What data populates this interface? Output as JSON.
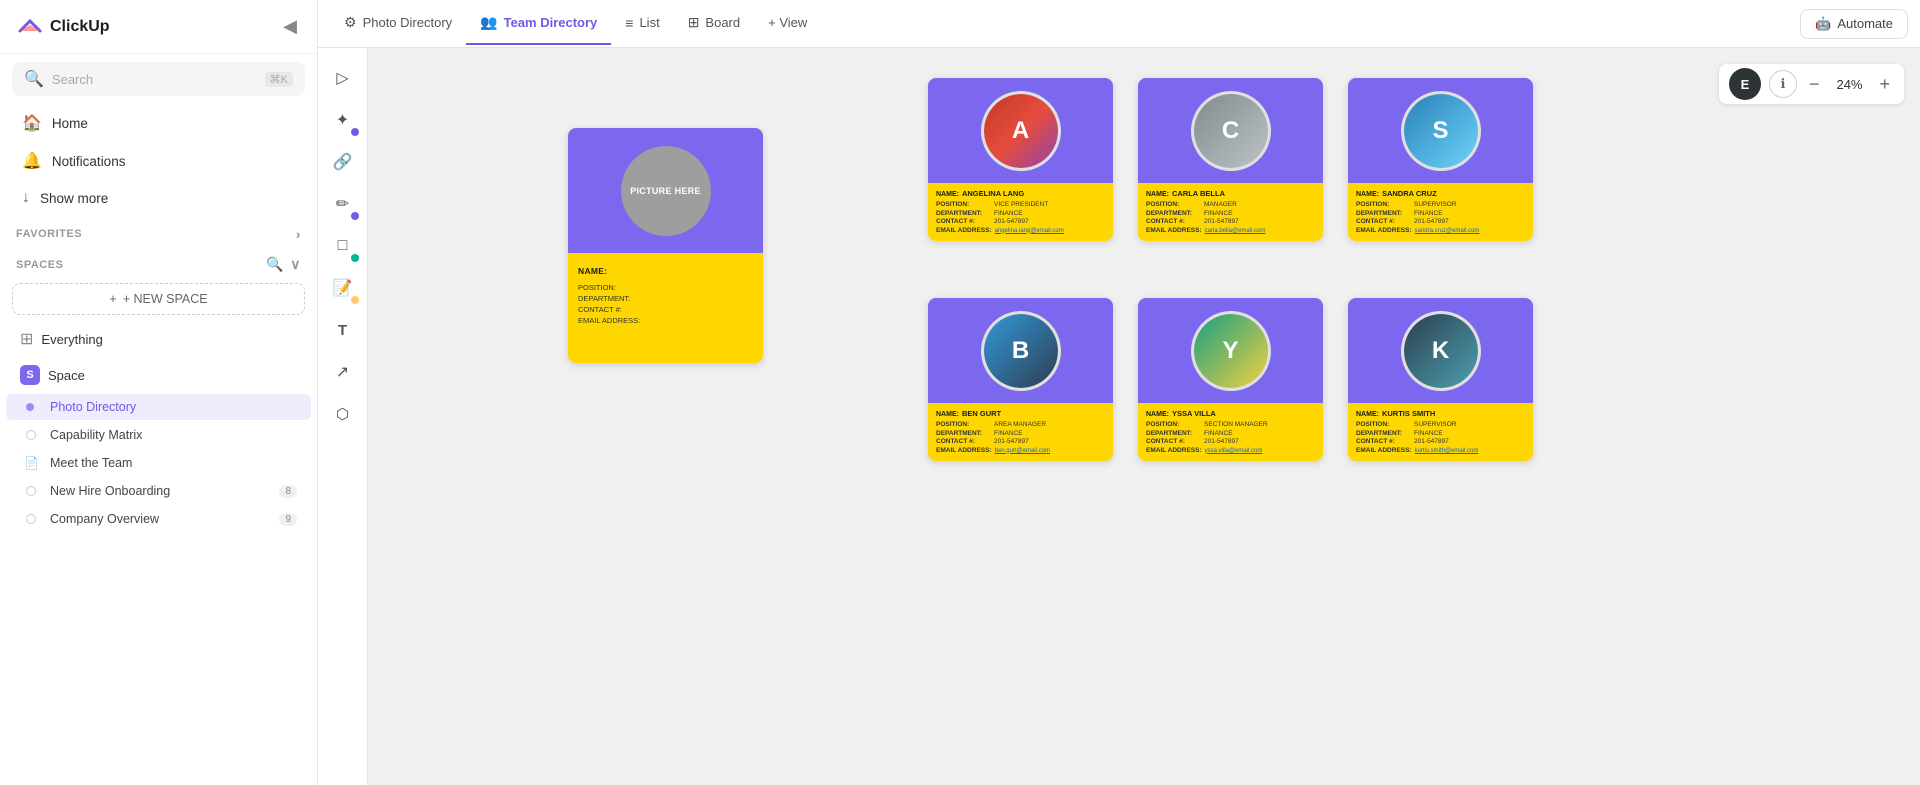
{
  "app": {
    "name": "ClickUp"
  },
  "sidebar": {
    "collapse_label": "◀",
    "search_placeholder": "Search",
    "search_shortcut": "⌘K",
    "nav": [
      {
        "id": "home",
        "label": "Home",
        "icon": "🏠"
      },
      {
        "id": "notifications",
        "label": "Notifications",
        "icon": "🔔"
      },
      {
        "id": "show-more",
        "label": "Show more",
        "icon": "↓"
      }
    ],
    "favorites_label": "FAVORITES",
    "spaces_label": "SPACES",
    "new_space_label": "+ NEW SPACE",
    "space_name": "Space",
    "space_badge": "S",
    "items": [
      {
        "id": "everything",
        "label": "Everything",
        "icon": "⊞",
        "indent": false
      },
      {
        "id": "space",
        "label": "Space",
        "badge": "S",
        "indent": false
      },
      {
        "id": "photo-directory",
        "label": "Photo Directory",
        "active": true,
        "indent": true
      },
      {
        "id": "capability-matrix",
        "label": "Capability Matrix",
        "indent": true
      },
      {
        "id": "meet-the-team",
        "label": "Meet the Team",
        "doc": true,
        "indent": true
      },
      {
        "id": "new-hire-onboarding",
        "label": "New Hire Onboarding",
        "count": 8,
        "indent": true
      },
      {
        "id": "company-overview",
        "label": "Company Overview",
        "count": 9,
        "indent": true
      }
    ]
  },
  "tabs": [
    {
      "id": "photo-directory",
      "label": "Photo Directory",
      "icon": "⚙",
      "active": false
    },
    {
      "id": "team-directory",
      "label": "Team Directory",
      "icon": "👥",
      "active": true
    },
    {
      "id": "list",
      "label": "List",
      "icon": "≡",
      "active": false
    },
    {
      "id": "board",
      "label": "Board",
      "icon": "⊞",
      "active": false
    },
    {
      "id": "view",
      "label": "+ View",
      "icon": "",
      "active": false
    }
  ],
  "automate_label": "Automate",
  "zoom": {
    "level": "24%",
    "user_initial": "E",
    "minus_label": "−",
    "plus_label": "+"
  },
  "tools": [
    {
      "id": "select",
      "icon": "▷"
    },
    {
      "id": "add",
      "icon": "✦",
      "dot": "blue"
    },
    {
      "id": "link",
      "icon": "🔗"
    },
    {
      "id": "pen",
      "icon": "✏",
      "dot": "blue"
    },
    {
      "id": "shape",
      "icon": "□"
    },
    {
      "id": "note",
      "icon": "📝",
      "dot": "green"
    },
    {
      "id": "text",
      "icon": "T"
    },
    {
      "id": "arrow",
      "icon": "↗"
    },
    {
      "id": "connect",
      "icon": "⬡"
    }
  ],
  "template_card": {
    "picture_label": "PICTURE HERE",
    "name_label": "NAME:",
    "position_label": "POSITION:",
    "department_label": "DEPARTMENT:",
    "contact_label": "CONTACT #:",
    "email_label": "EMAIL ADDRESS:"
  },
  "profiles": [
    {
      "id": "angelina-lang",
      "name": "ANGELINA LANG",
      "position": "VICE PRESIDENT",
      "department": "FINANCE",
      "contact": "201-547897",
      "email": "angelina.lang@email.com",
      "photo_class": "p1",
      "initial": "A",
      "row": 0,
      "col": 0
    },
    {
      "id": "carla-bella",
      "name": "CARLA BELLA",
      "position": "MANAGER",
      "department": "FINANCE",
      "contact": "201-547897",
      "email": "carla.bella@email.com",
      "photo_class": "p2",
      "initial": "C",
      "row": 0,
      "col": 1
    },
    {
      "id": "sandra-cruz",
      "name": "SANDRA CRUZ",
      "position": "SUPERVISOR",
      "department": "FINANCE",
      "contact": "201-547897",
      "email": "sandra.cruz@email.com",
      "photo_class": "p3",
      "initial": "S",
      "row": 0,
      "col": 2
    },
    {
      "id": "ben-gurt",
      "name": "BEN GURT",
      "position": "AREA MANAGER",
      "department": "FINANCE",
      "contact": "201-547897",
      "email": "ben.gurt@email.com",
      "photo_class": "p4",
      "initial": "B",
      "row": 1,
      "col": 0
    },
    {
      "id": "yssa-villa",
      "name": "YSSA VILLA",
      "position": "SECTION MANAGER",
      "department": "FINANCE",
      "contact": "201-547897",
      "email": "yssa.villa@email.com",
      "photo_class": "p5",
      "initial": "Y",
      "row": 1,
      "col": 1
    },
    {
      "id": "kurtis-smith",
      "name": "KURTIS SMITH",
      "position": "SUPERVISOR",
      "department": "FINANCE",
      "contact": "201-547897",
      "email": "kurtis.smith@email.com",
      "photo_class": "p6",
      "initial": "K",
      "row": 1,
      "col": 2
    }
  ]
}
